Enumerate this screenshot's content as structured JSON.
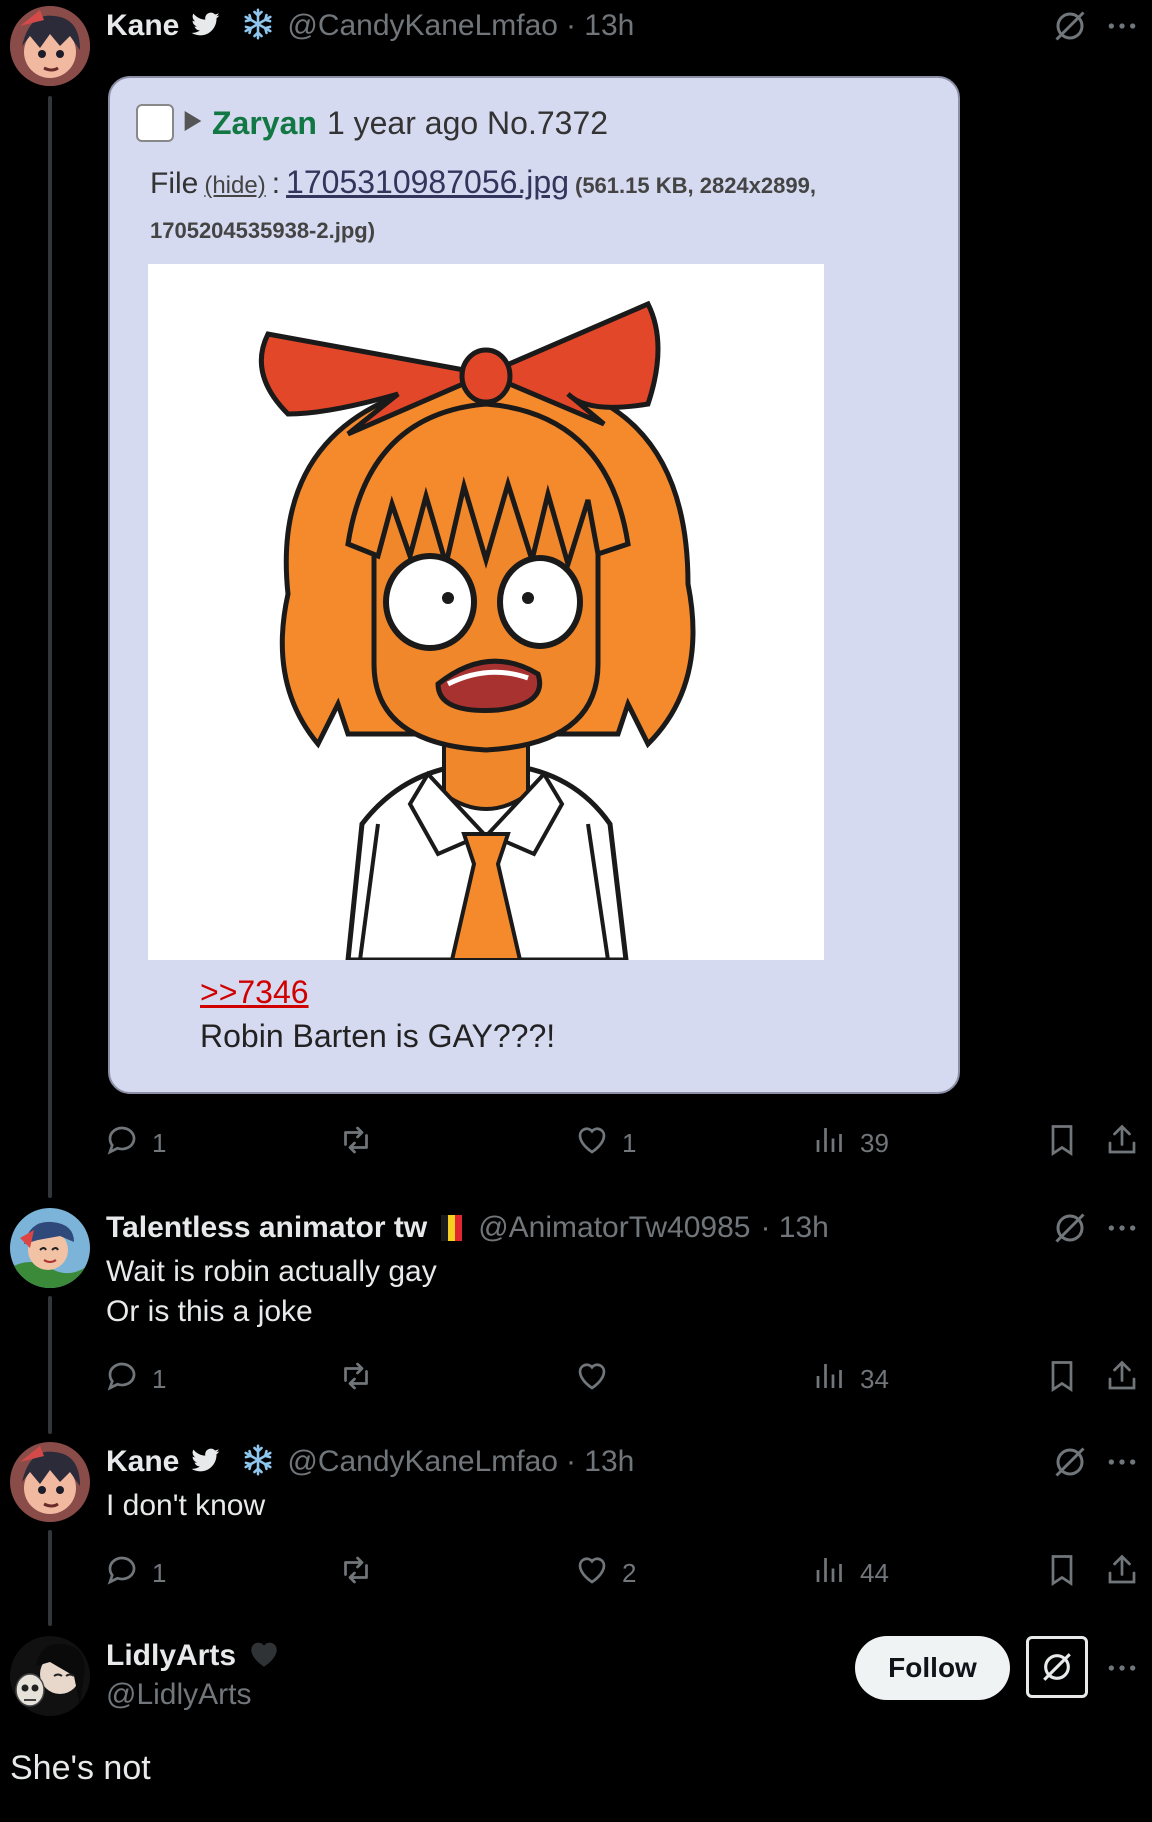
{
  "tweets": [
    {
      "name": "Kane",
      "handle": "@CandyKaneLmfao",
      "time": "· 13h",
      "stats": {
        "replies": "1",
        "retweets": "",
        "likes": "1",
        "views": "39"
      },
      "embed": {
        "poster": "Zaryan",
        "meta": "1 year ago No.7372",
        "file_label": "File",
        "hide_label": "(hide)",
        "file_sep": ":",
        "file_name": "1705310987056.jpg",
        "file_info": "(561.15 KB, 2824x2899,",
        "file_orig": "1705204535938-2.jpg)",
        "quote_link": ">>7346",
        "message": "Robin Barten is GAY???!"
      }
    },
    {
      "name": "Talentless animator tw",
      "handle": "@AnimatorTw40985",
      "time": "· 13h",
      "text_line1": "Wait is robin actually gay",
      "text_line2": "Or is this a joke",
      "stats": {
        "replies": "1",
        "retweets": "",
        "likes": "",
        "views": "34"
      }
    },
    {
      "name": "Kane",
      "handle": "@CandyKaneLmfao",
      "time": "· 13h",
      "text_line1": "I don't know",
      "stats": {
        "replies": "1",
        "retweets": "",
        "likes": "2",
        "views": "44"
      }
    }
  ],
  "main_tweet": {
    "name": "LidlyArts",
    "handle": "@LidlyArts",
    "follow_label": "Follow",
    "text": "She's not"
  },
  "colors": {
    "background": "#000000",
    "text": "#e7e9ea",
    "muted": "#71767b",
    "card_bg": "#d6daf0",
    "poster_green": "#117743",
    "link_red": "#d00000",
    "hair_orange": "#f58a2c",
    "bow_red": "#e2472a"
  },
  "icons": [
    "verified-bird-icon",
    "snowflake-icon",
    "grok-icon",
    "more-icon",
    "reply-icon",
    "retweet-icon",
    "like-icon",
    "views-icon",
    "bookmark-icon",
    "share-icon",
    "heart-badge-icon",
    "checkbox-icon",
    "triangle-icon"
  ]
}
